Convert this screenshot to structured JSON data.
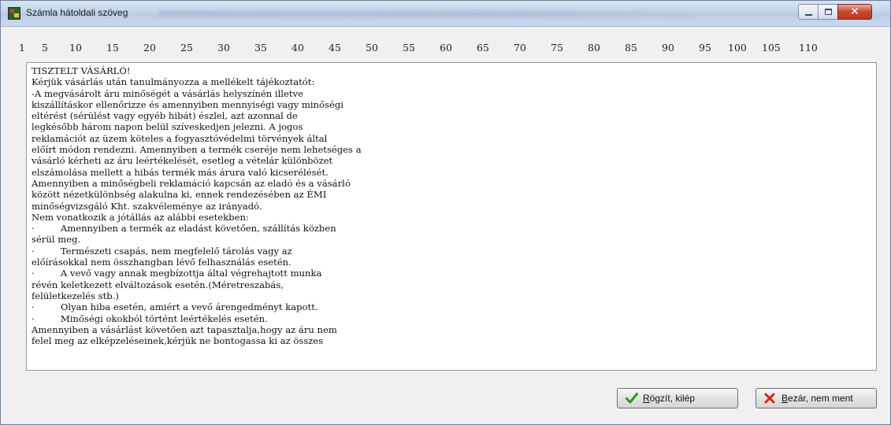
{
  "window": {
    "title": "Számla hátoldali szöveg"
  },
  "ruler": [
    "1",
    "5",
    "10",
    "15",
    "20",
    "25",
    "30",
    "35",
    "40",
    "45",
    "50",
    "55",
    "60",
    "65",
    "70",
    "75",
    "80",
    "85",
    "90",
    "95",
    "100",
    "105",
    "110"
  ],
  "editor": {
    "lines": [
      "TISZTELT VÁSÁRLÓ!",
      "Kérjük vásárlás után tanulmányozza a mellékelt tájékoztatót:",
      "-A megvásárolt áru minőségét a vásárlás helyszínén illetve",
      "kiszállításkor ellenőrizze és amennyiben mennyiségi vagy minőségi",
      "eltérést (sérülést vagy egyéb hibát) észlel, azt azonnal de",
      "legkésőbb három napon belül szíveskedjen jelezni. A jogos",
      "reklamációt az üzem köteles a fogyasztóvédelmi törvények által",
      "előírt módon rendezni. Amennyiben a termék cseréje nem lehetséges a",
      "vásárló kérheti az áru leértékelését, esetleg a vételár különbözet",
      "elszámolása mellett a hibás termék más árura való kicserélését.",
      "Amennyiben a minőségbeli reklamáció kapcsán az eladó és a vásárló",
      "között nézetkülönbség alakulna ki, ennek rendezésében az ÉMI",
      "minőségvizsgáló Kht. szakvéleménye az irányadó.",
      "Nem vonatkozik a jótállás az alábbi esetekben:",
      "·         Amennyiben a termék az eladást követően, szállítás közben",
      "sérül meg.",
      "·         Természeti csapás, nem megfelelő tárolás vagy az",
      "előírásokkal nem összhangban lévő felhasználás esetén.",
      "·         A vevő vagy annak megbízottja által végrehajtott munka",
      "révén keletkezett elváltozások esetén.(Méretreszabás,",
      "felületkezelés stb.)",
      "·         Olyan hiba esetén, amiért a vevő árengedményt kapott.",
      "·         Minőségi okokból történt leértékelés esetén.",
      "Amennyiben a vásárlást követően azt tapasztalja,hogy az áru nem",
      "felel meg az elképzeléseinek,kérjük ne bontogassa ki az összes"
    ]
  },
  "buttons": {
    "save": {
      "mnemonic": "R",
      "rest": "ögzít, kilép",
      "icon": "check-icon"
    },
    "cancel": {
      "mnemonic": "B",
      "rest": "ezár, nem ment",
      "icon": "x-icon"
    }
  },
  "colors": {
    "check": "#2e9a1c",
    "x": "#d32a1a"
  }
}
